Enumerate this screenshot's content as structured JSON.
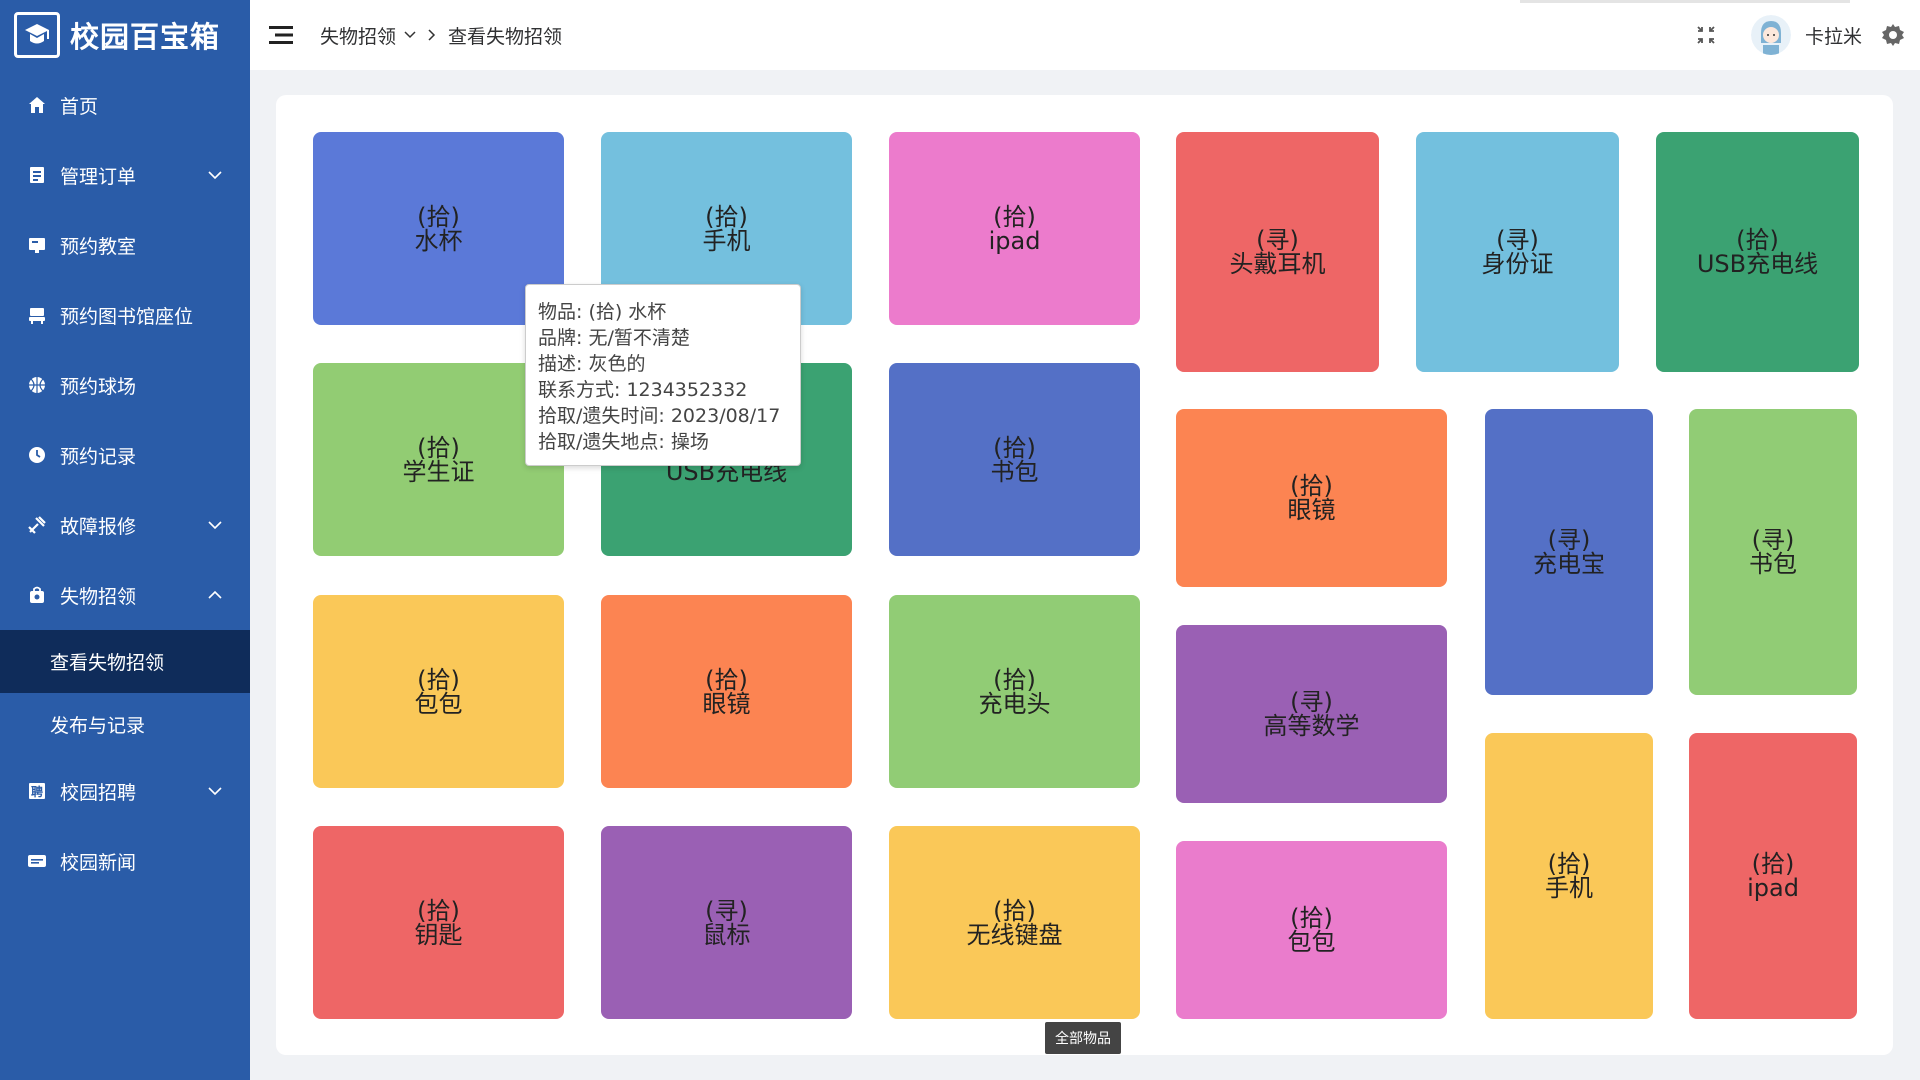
{
  "app": {
    "title": "校园百宝箱"
  },
  "sidebar": {
    "items": [
      {
        "label": "首页",
        "icon": "home-icon"
      },
      {
        "label": "管理订单",
        "icon": "order-icon",
        "expandable": true
      },
      {
        "label": "预约教室",
        "icon": "classroom-icon"
      },
      {
        "label": "预约图书馆座位",
        "icon": "library-seat-icon"
      },
      {
        "label": "预约球场",
        "icon": "ball-icon"
      },
      {
        "label": "预约记录",
        "icon": "clock-icon"
      },
      {
        "label": "故障报修",
        "icon": "repair-icon",
        "expandable": true
      },
      {
        "label": "失物招领",
        "icon": "bag-icon",
        "expanded": true
      },
      {
        "label": "校园招聘",
        "icon": "recruit-icon",
        "expandable": true
      },
      {
        "label": "校园新闻",
        "icon": "news-icon"
      }
    ],
    "subitems": [
      {
        "label": "查看失物招领",
        "active": true
      },
      {
        "label": "发布与记录",
        "active": false
      }
    ]
  },
  "header": {
    "breadcrumb": [
      "失物招领",
      "查看失物招领"
    ],
    "username": "卡拉米"
  },
  "tiles": [
    {
      "tag": "(拾)",
      "name": "水杯",
      "color": "#5b79d8"
    },
    {
      "tag": "(拾)",
      "name": "手机",
      "color": "#74c0de"
    },
    {
      "tag": "(拾)",
      "name": "ipad",
      "color": "#ec7bcc"
    },
    {
      "tag": "(拾)",
      "name": "学生证",
      "color": "#92cc73"
    },
    {
      "tag": "(拾)",
      "name": "USB充电线",
      "color": "#3ba272"
    },
    {
      "tag": "(拾)",
      "name": "书包",
      "color": "#5470c6"
    },
    {
      "tag": "(拾)",
      "name": "包包",
      "color": "#fac858"
    },
    {
      "tag": "(拾)",
      "name": "眼镜",
      "color": "#fc8452"
    },
    {
      "tag": "(拾)",
      "name": "充电头",
      "color": "#91cc75"
    },
    {
      "tag": "(拾)",
      "name": "钥匙",
      "color": "#ee6666"
    },
    {
      "tag": "(寻)",
      "name": "鼠标",
      "color": "#9a60b4"
    },
    {
      "tag": "(拾)",
      "name": "无线键盘",
      "color": "#fac858"
    },
    {
      "tag": "(寻)",
      "name": "头戴耳机",
      "color": "#ee6666"
    },
    {
      "tag": "(寻)",
      "name": "身份证",
      "color": "#73c0de"
    },
    {
      "tag": "(拾)",
      "name": "USB充电线",
      "color": "#3ba272"
    },
    {
      "tag": "(拾)",
      "name": "眼镜",
      "color": "#fc8452"
    },
    {
      "tag": "(寻)",
      "name": "充电宝",
      "color": "#5470c6"
    },
    {
      "tag": "(寻)",
      "name": "书包",
      "color": "#91cc75"
    },
    {
      "tag": "(寻)",
      "name": "高等数学",
      "color": "#9a60b4"
    },
    {
      "tag": "(拾)",
      "name": "手机",
      "color": "#fac858"
    },
    {
      "tag": "(拾)",
      "name": "ipad",
      "color": "#ee6666"
    },
    {
      "tag": "(拾)",
      "name": "包包",
      "color": "#ea7ccc"
    }
  ],
  "tooltip": {
    "lines": [
      "物品: (拾) 水杯",
      "品牌: 无/暂不清楚",
      "描述: 灰色的",
      "联系方式: 1234352332",
      "拾取/遗失时间: 2023/08/17",
      "拾取/遗失地点: 操场"
    ]
  },
  "footer": {
    "label": "全部物品"
  }
}
